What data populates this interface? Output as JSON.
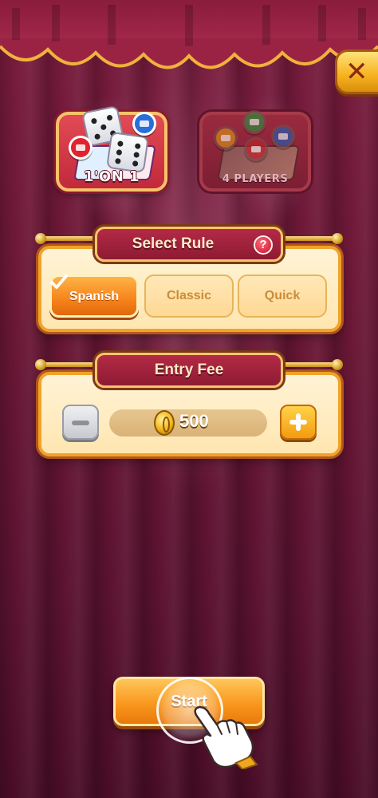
{
  "modes": {
    "one_on_one_label": "1'ON 1",
    "four_players_label": "4 PLAYERS",
    "selected": "one_on_one"
  },
  "rule": {
    "title": "Select Rule",
    "help_glyph": "?",
    "options": [
      "Spanish",
      "Classic",
      "Quick"
    ],
    "selected": "Spanish"
  },
  "fee": {
    "title": "Entry Fee",
    "value": "500"
  },
  "start": {
    "label": "Start"
  },
  "colors": {
    "accent": "#f57f17",
    "panel": "#ffe6b0",
    "header": "#a42240",
    "background": "#6a1735"
  }
}
